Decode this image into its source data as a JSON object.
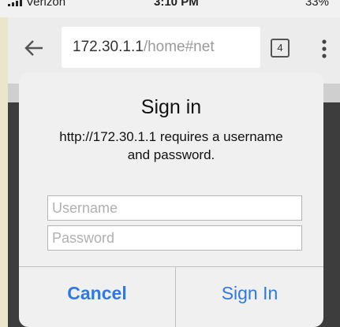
{
  "status_bar": {
    "carrier": "Verizon",
    "time": "3:10 PM",
    "battery": "33%"
  },
  "browser": {
    "url_host": "172.30.1.1",
    "url_path": "/home#net",
    "tab_count": "4"
  },
  "dialog": {
    "title": "Sign in",
    "message": "http://172.30.1.1 requires a username and password.",
    "username_placeholder": "Username",
    "password_placeholder": "Password",
    "cancel_label": "Cancel",
    "signin_label": "Sign In"
  },
  "colors": {
    "accent": "#2f79e4",
    "dialog_bg": "#f0f0f0",
    "dimmed_page": "#3d3d3d",
    "border": "#e9e6cc"
  }
}
